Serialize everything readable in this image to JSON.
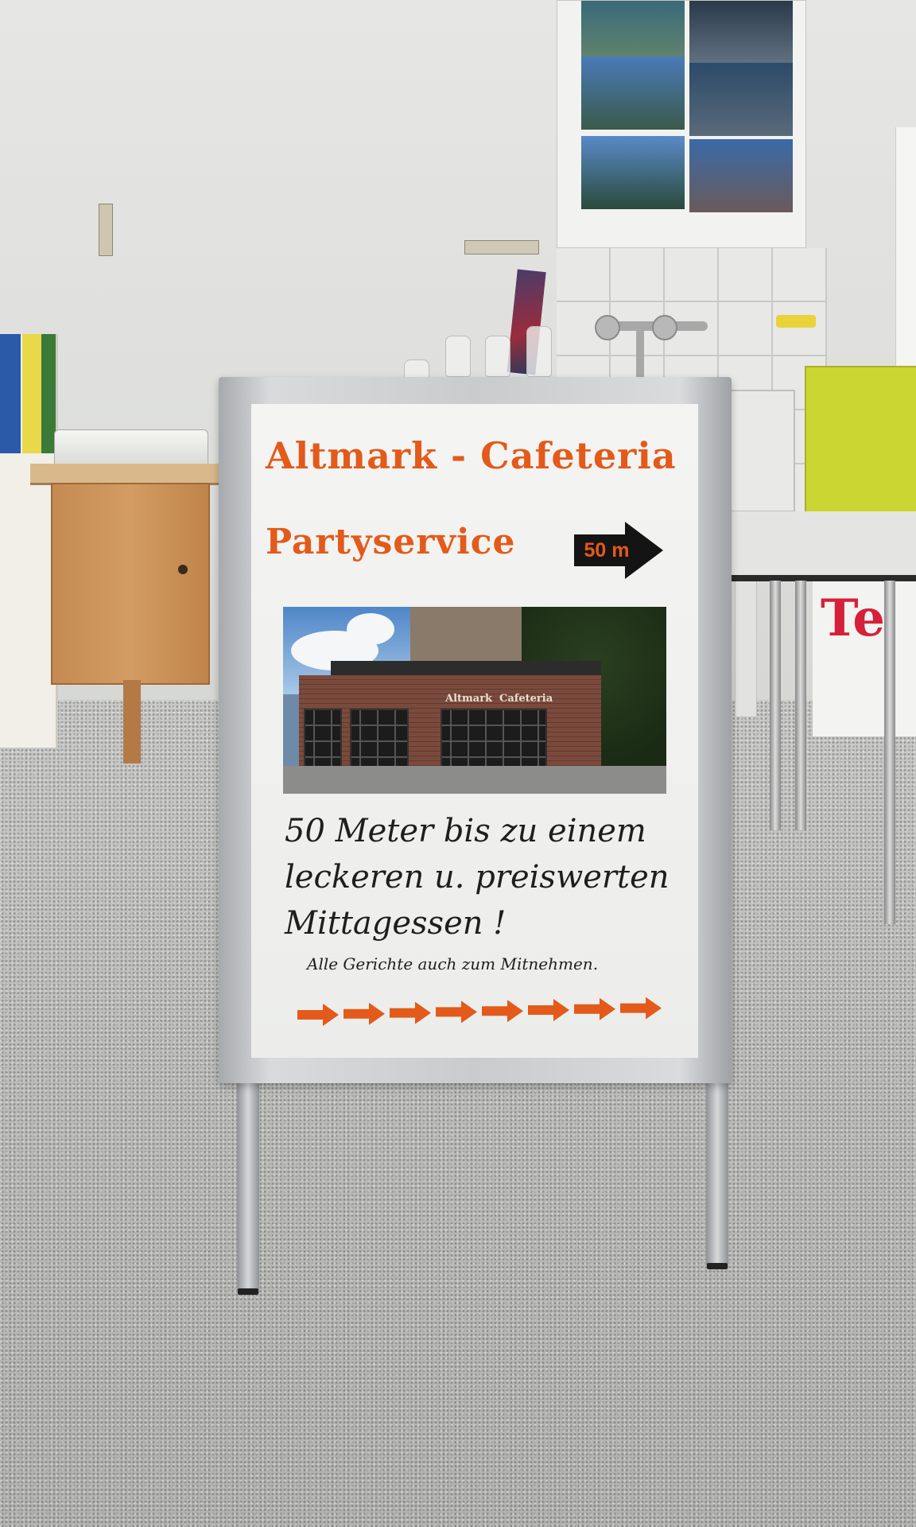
{
  "sign": {
    "title_line1": "Altmark - Cafeteria",
    "title_line2": "Partyservice",
    "distance": "50 m",
    "photo_facade": [
      "Altmark",
      "Cafeteria"
    ],
    "body_lines": [
      "50 Meter bis zu einem",
      "leckeren u. preiswerten",
      "Mittagessen !"
    ],
    "note": "Alle Gerichte auch zum Mitnehmen.",
    "arrow_count": 8,
    "accent_color": "#e35a1a"
  },
  "background": {
    "red_sign_text": "Te",
    "red_sign_color": "#d6203a"
  }
}
